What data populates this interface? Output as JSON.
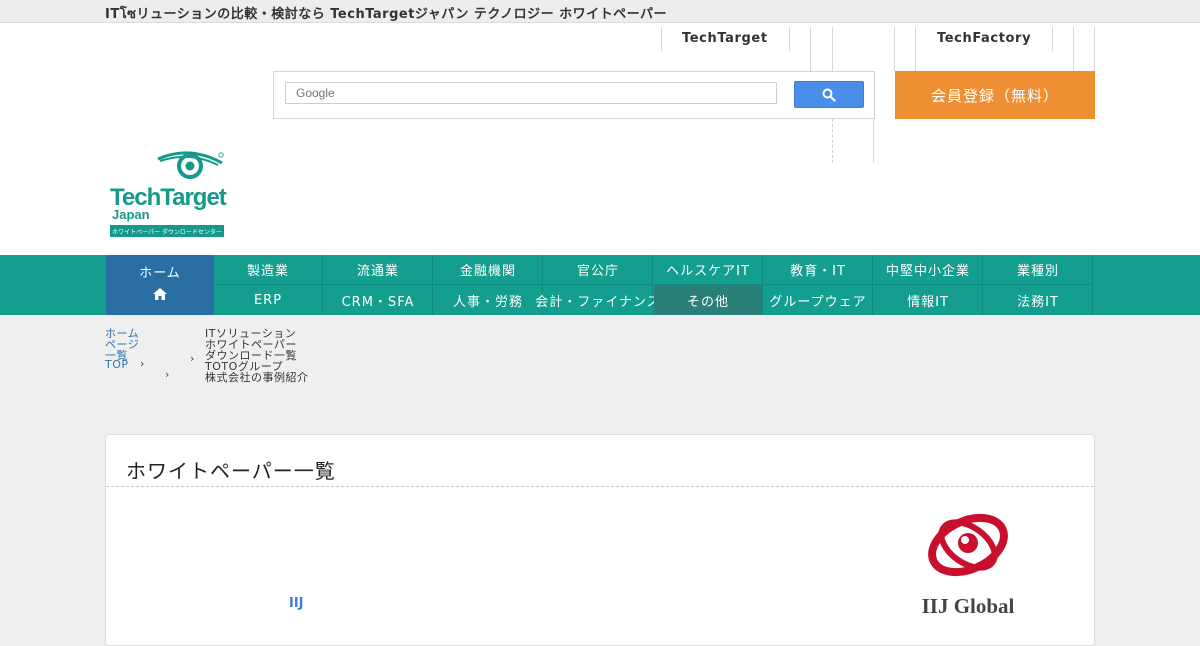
{
  "topbar": {
    "text": "ITโซリューションの比較・検討なら TechTargetジャパン テクノロジー ホワイトペーパー"
  },
  "header": {
    "links": [
      "TechTarget",
      "TechFactory"
    ],
    "search": {
      "placeholder": "Google"
    },
    "cta_label": "会員登録（無料）"
  },
  "logo": {
    "brand": "TechTarget",
    "sub": "Japan",
    "tagline": "ホワイトペーパー ダウンロードセンター",
    "color": "#14998a"
  },
  "nav": {
    "home_label": "ホーム",
    "row1": [
      "製造業",
      "流通業",
      "金融機関",
      "官公庁",
      "ヘルスケアIT",
      "教育・IT",
      "中堅中小企業",
      "業種別"
    ],
    "row2": [
      "ERP",
      "CRM・SFA",
      "人事・労務",
      "会計・ファイナンス",
      "その他",
      "グループウェア",
      "情報IT",
      "法務IT"
    ],
    "active_row2_index": 4,
    "colors": {
      "bar": "#139e8f",
      "home": "#2a6fa3",
      "active": "#2b7f79"
    }
  },
  "breadcrumb": {
    "home_lines": [
      "ホーム",
      "ページ",
      "一覧",
      "TOP"
    ],
    "trail_lines": [
      "ITソリューション",
      "ホワイトペーパー",
      "ダウンロード一覧",
      "TOTOグループ",
      "株式会社の事例紹介"
    ]
  },
  "card": {
    "title": "ホワイトペーパー一覧",
    "company_link": "IIJ",
    "company_logo_text": "IIJ Global",
    "logo_color": "#c8102e"
  }
}
